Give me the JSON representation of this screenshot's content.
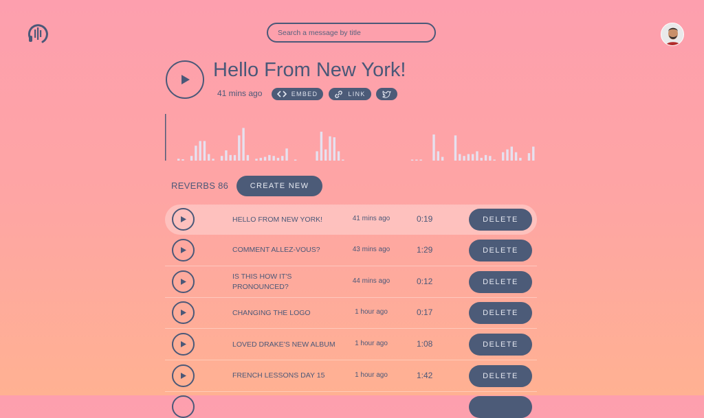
{
  "header": {
    "logo_icon": "audio-wave-headphones-icon",
    "search_placeholder": "Search a message by title",
    "avatar_icon": "user-avatar"
  },
  "message": {
    "title": "Hello From New York!",
    "time_ago": "41 mins ago",
    "embed_label": "EMBED",
    "link_label": "LINK",
    "twitter_icon": "twitter-icon"
  },
  "reverbs": {
    "label": "REVERBS 86",
    "create_label": "CREATE NEW"
  },
  "rows": [
    {
      "title": "HELLO FROM NEW YORK!",
      "ago": "41 mins ago",
      "duration": "0:19",
      "delete": "DELETE",
      "active": true
    },
    {
      "title": "COMMENT ALLEZ-VOUS?",
      "ago": "43 mins ago",
      "duration": "1:29",
      "delete": "DELETE"
    },
    {
      "title": "IS THIS HOW IT'S PRONOUNCED?",
      "ago": "44 mins ago",
      "duration": "0:12",
      "delete": "DELETE"
    },
    {
      "title": "CHANGING THE LOGO",
      "ago": "1 hour ago",
      "duration": "0:17",
      "delete": "DELETE"
    },
    {
      "title": "LOVED DRAKE'S NEW ALBUM",
      "ago": "1 hour ago",
      "duration": "1:08",
      "delete": "DELETE"
    },
    {
      "title": "FRENCH LESSONS DAY 15",
      "ago": "1 hour ago",
      "duration": "1:42",
      "delete": "DELETE"
    }
  ],
  "colors": {
    "accent": "#4c5b78",
    "wave": "#e6e1ef",
    "bg_top": "#fd9fae",
    "bg_bottom": "#ffb192"
  },
  "waveform_levels": [
    0.04,
    0.03,
    0,
    0.1,
    0.32,
    0.42,
    0.42,
    0.14,
    0.04,
    0,
    0.1,
    0.22,
    0.12,
    0.12,
    0.54,
    0.7,
    0.12,
    0,
    0.04,
    0.06,
    0.08,
    0.12,
    0.1,
    0.06,
    0.1,
    0.26,
    0,
    0.02,
    0,
    0,
    0,
    0,
    0.2,
    0.62,
    0.24,
    0.52,
    0.5,
    0.2,
    0.02,
    0,
    0,
    0,
    0,
    0,
    0,
    0,
    0,
    0,
    0,
    0,
    0,
    0,
    0,
    0,
    0.02,
    0.02,
    0.02,
    0,
    0,
    0.56,
    0.2,
    0.08,
    0,
    0,
    0.54,
    0.14,
    0.1,
    0.14,
    0.14,
    0.2,
    0.06,
    0.12,
    0.1,
    0.02,
    0,
    0.18,
    0.24,
    0.3,
    0.18,
    0.06,
    0,
    0.16,
    0.3
  ]
}
